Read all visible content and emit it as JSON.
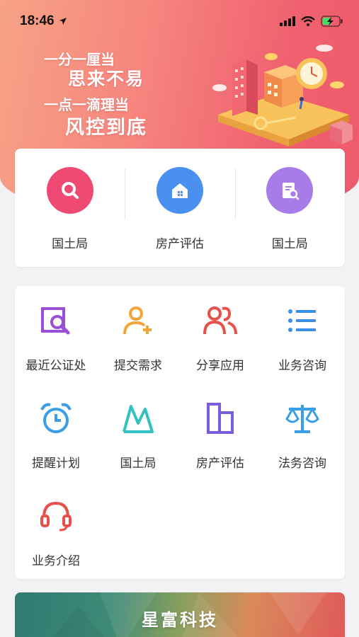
{
  "status_bar": {
    "time": "18:46"
  },
  "hero": {
    "slogan": [
      "一分一厘当",
      "思来不易",
      "一点一滴理当",
      "风控到底"
    ]
  },
  "quick_actions": [
    {
      "label": "国土局",
      "icon": "search-icon",
      "color": "#ee4a73"
    },
    {
      "label": "房产评估",
      "icon": "house-icon",
      "color": "#4a90f0"
    },
    {
      "label": "国土局",
      "icon": "document-search-icon",
      "color": "#a77be8"
    }
  ],
  "services": [
    {
      "label": "最近公证处",
      "icon": "magnifier-document-icon",
      "color": "#9b4fd8"
    },
    {
      "label": "提交需求",
      "icon": "add-user-icon",
      "color": "#f2a53a"
    },
    {
      "label": "分享应用",
      "icon": "users-icon",
      "color": "#e8504a"
    },
    {
      "label": "业务咨询",
      "icon": "list-icon",
      "color": "#3a8fe8"
    },
    {
      "label": "提醒计划",
      "icon": "alarm-clock-icon",
      "color": "#3a9de8"
    },
    {
      "label": "国土局",
      "icon": "mountain-icon",
      "color": "#33c2c2"
    },
    {
      "label": "房产评估",
      "icon": "building-icon",
      "color": "#7a5ce0"
    },
    {
      "label": "法务咨询",
      "icon": "scale-icon",
      "color": "#3a9de8"
    },
    {
      "label": "业务介绍",
      "icon": "headset-icon",
      "color": "#e8504a"
    }
  ],
  "banner": {
    "title": "星富科技"
  }
}
